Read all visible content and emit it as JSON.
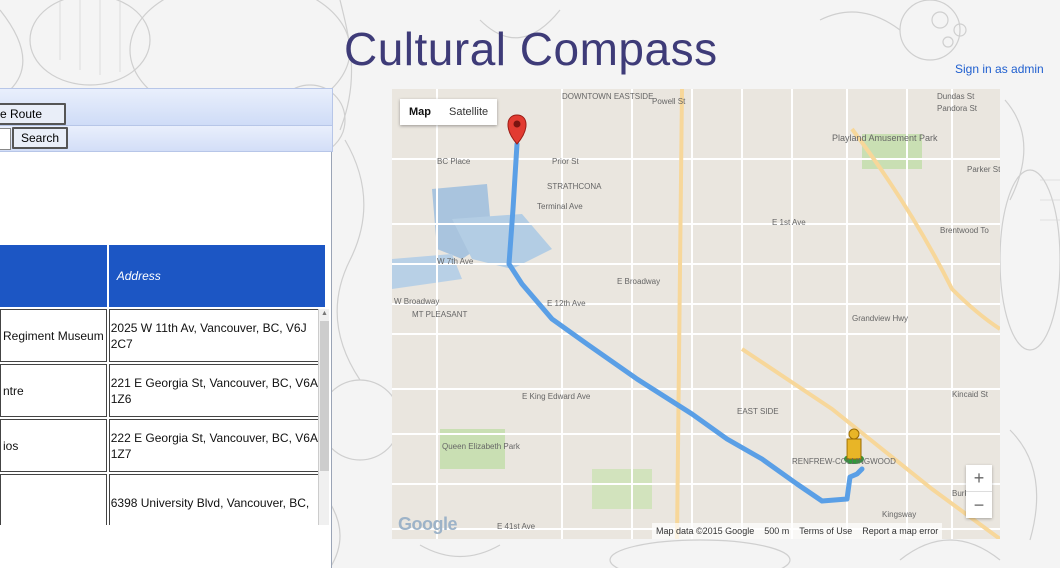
{
  "header": {
    "title": "Cultural Compass",
    "signin_label": "Sign in as admin"
  },
  "controls": {
    "route_button_label": "ve Route",
    "search_input_value": "",
    "search_button_label": "Search"
  },
  "table": {
    "headers": [
      "",
      "Address"
    ],
    "rows": [
      {
        "name": "Regiment Museum",
        "address": "2025 W 11th Av, Vancouver, BC, V6J 2C7"
      },
      {
        "name": "ntre",
        "address": "221 E Georgia St, Vancouver, BC, V6A 1Z6"
      },
      {
        "name": "ios",
        "address": "222 E Georgia St, Vancouver, BC, V6A 1Z7"
      },
      {
        "name": "",
        "address": "6398 University Blvd, Vancouver, BC,"
      }
    ]
  },
  "map": {
    "type_options": [
      "Map",
      "Satellite"
    ],
    "selected_type": "Map",
    "labels": {
      "downtown": "DOWNTOWN EASTSIDE",
      "bc_place": "BC Place",
      "strathcona": "STRATHCONA",
      "playland": "Playland Amusement Park",
      "terminal_ave": "Terminal Ave",
      "e_broadway": "E Broadway",
      "w_broadway": "W Broadway",
      "mt_pleasant": "MT PLEASANT",
      "e_12th": "E 12th Ave",
      "w_7th": "W 7th Ave",
      "e_king_edward": "E King Edward Ave",
      "queen_elizabeth": "Queen Elizabeth Park",
      "renfrew": "RENFREW-COLLINGWOOD",
      "kingsway": "Kingsway",
      "brentwood": "Brentwood To",
      "grandview": "Grandview Hwy",
      "e_1st": "E 1st Ave",
      "kincaid": "Kincaid St",
      "e_41st": "E 41st Ave",
      "burke": "Burke",
      "prior": "Prior St",
      "powell": "Powell St",
      "dundas": "Dundas St",
      "pandora": "Pandora St",
      "parker": "Parker St",
      "east_side": "EAST SIDE"
    },
    "footer": {
      "map_data": "Map data ©2015 Google",
      "scale": "500 m",
      "terms": "Terms of Use",
      "report": "Report a map error"
    },
    "logo": "Google",
    "colors": {
      "route": "#5a9fe6",
      "header_blue": "#1c56c4",
      "title": "#3e3b78",
      "link": "#1f5fcf"
    }
  }
}
